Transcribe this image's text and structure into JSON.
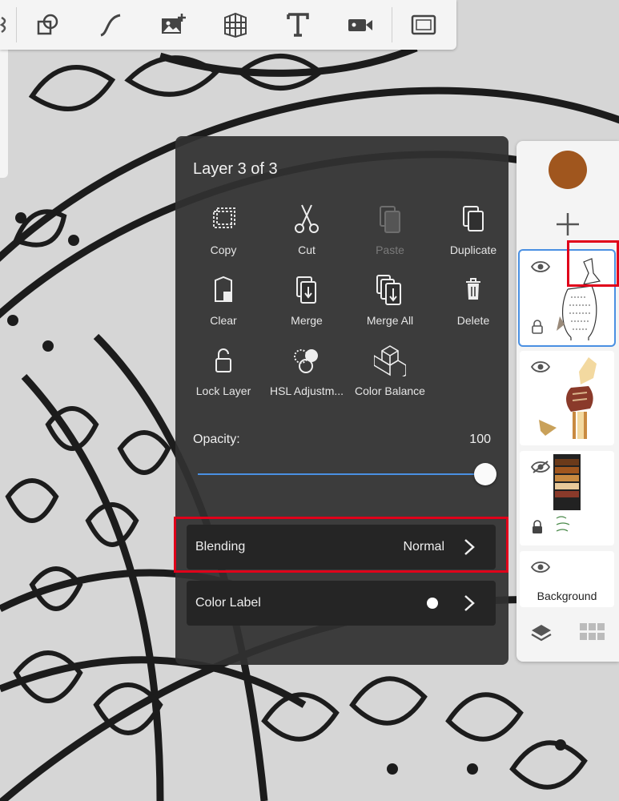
{
  "toolbar": {
    "tools": [
      "symmetry-icon",
      "shapes-icon",
      "curve-icon",
      "add-image-icon",
      "perspective-grid-icon",
      "text-icon",
      "record-video-icon",
      "fullscreen-icon"
    ]
  },
  "layer_menu": {
    "title": "Layer 3 of 3",
    "actions": {
      "copy": "Copy",
      "cut": "Cut",
      "paste": "Paste",
      "duplicate": "Duplicate",
      "clear": "Clear",
      "merge": "Merge",
      "merge_all": "Merge All",
      "delete": "Delete",
      "lock_layer": "Lock Layer",
      "hsl": "HSL Adjustm...",
      "color_balance": "Color Balance"
    },
    "opacity_label": "Opacity:",
    "opacity_value": "100",
    "opacity_level": 1.0,
    "blending_label": "Blending",
    "blending_value": "Normal",
    "color_label": "Color Label"
  },
  "layers_panel": {
    "current_color": "#a0561e",
    "background_label": "Background"
  },
  "colors": {
    "accent": "#4a90e2",
    "highlight": "#e0001a",
    "panel_bg": "#303030"
  }
}
